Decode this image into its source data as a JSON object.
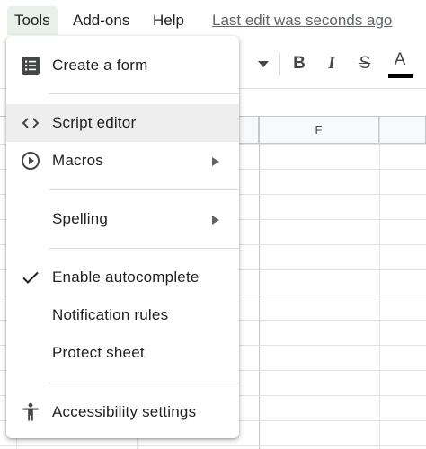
{
  "menubar": {
    "items": [
      {
        "label": "Tools"
      },
      {
        "label": "Add-ons"
      },
      {
        "label": "Help"
      }
    ],
    "last_edit": "Last edit was seconds ago"
  },
  "toolbar": {
    "bold_label": "B",
    "italic_label": "I",
    "strike_label": "S",
    "text_color_label": "A",
    "text_color": "#000000"
  },
  "grid": {
    "column_headers": [
      "F"
    ]
  },
  "tools_menu": {
    "items": [
      {
        "label": "Create a form",
        "icon": "form-icon"
      },
      {
        "label": "Script editor",
        "icon": "code-icon",
        "highlighted": true
      },
      {
        "label": "Macros",
        "icon": "play-circle-icon",
        "submenu": true
      },
      {
        "label": "Spelling",
        "submenu": true
      },
      {
        "label": "Enable autocomplete",
        "icon": "checkmark-icon",
        "checked": true
      },
      {
        "label": "Notification rules"
      },
      {
        "label": "Protect sheet"
      },
      {
        "label": "Accessibility settings",
        "icon": "accessibility-icon"
      }
    ]
  },
  "colors": {
    "active_menu_bg": "#e8f0e9",
    "hover_item_bg": "#eeeeee",
    "text": "#202124",
    "icon": "#444746"
  }
}
